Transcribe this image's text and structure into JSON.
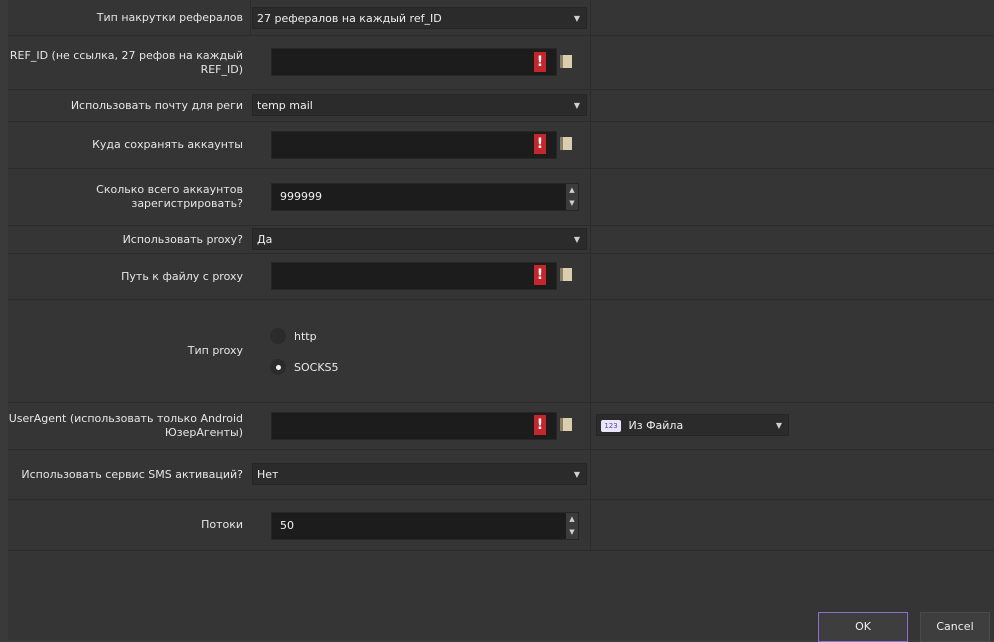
{
  "form": {
    "referral_type": {
      "label": "Тип накрутки рефералов",
      "value": "27 рефералов на каждый ref_ID"
    },
    "ref_id": {
      "label": "REF_ID (не ссылка, 27 рефов на каждый REF_ID)",
      "value": ""
    },
    "mail_for_reg": {
      "label": "Использовать почту для реги",
      "value": "temp mail"
    },
    "save_accounts": {
      "label": "Куда сохранять аккаунты",
      "value": ""
    },
    "accounts_total": {
      "label": "Сколько всего аккаунтов зарегистрировать?",
      "value": "999999"
    },
    "use_proxy": {
      "label": "Использовать proxy?",
      "value": "Да"
    },
    "proxy_file": {
      "label": "Путь к файлу с proxy",
      "value": ""
    },
    "proxy_type": {
      "label": "Тип proxy",
      "options": [
        {
          "label": "http",
          "selected": false
        },
        {
          "label": "SOCKS5",
          "selected": true
        }
      ]
    },
    "user_agent": {
      "label": "UserAgent (использовать только Android ЮзерАгенты)",
      "value": "",
      "source_badge": "123",
      "source": "Из Файла"
    },
    "sms_service": {
      "label": "Использовать сервис SMS активаций?",
      "value": "Нет"
    },
    "threads": {
      "label": "Потоки",
      "value": "50"
    }
  },
  "buttons": {
    "ok": "OK",
    "cancel": "Cancel"
  },
  "colors": {
    "background": "#353535",
    "warning": "#c5262c",
    "ok_border": "#8e6fcf"
  }
}
